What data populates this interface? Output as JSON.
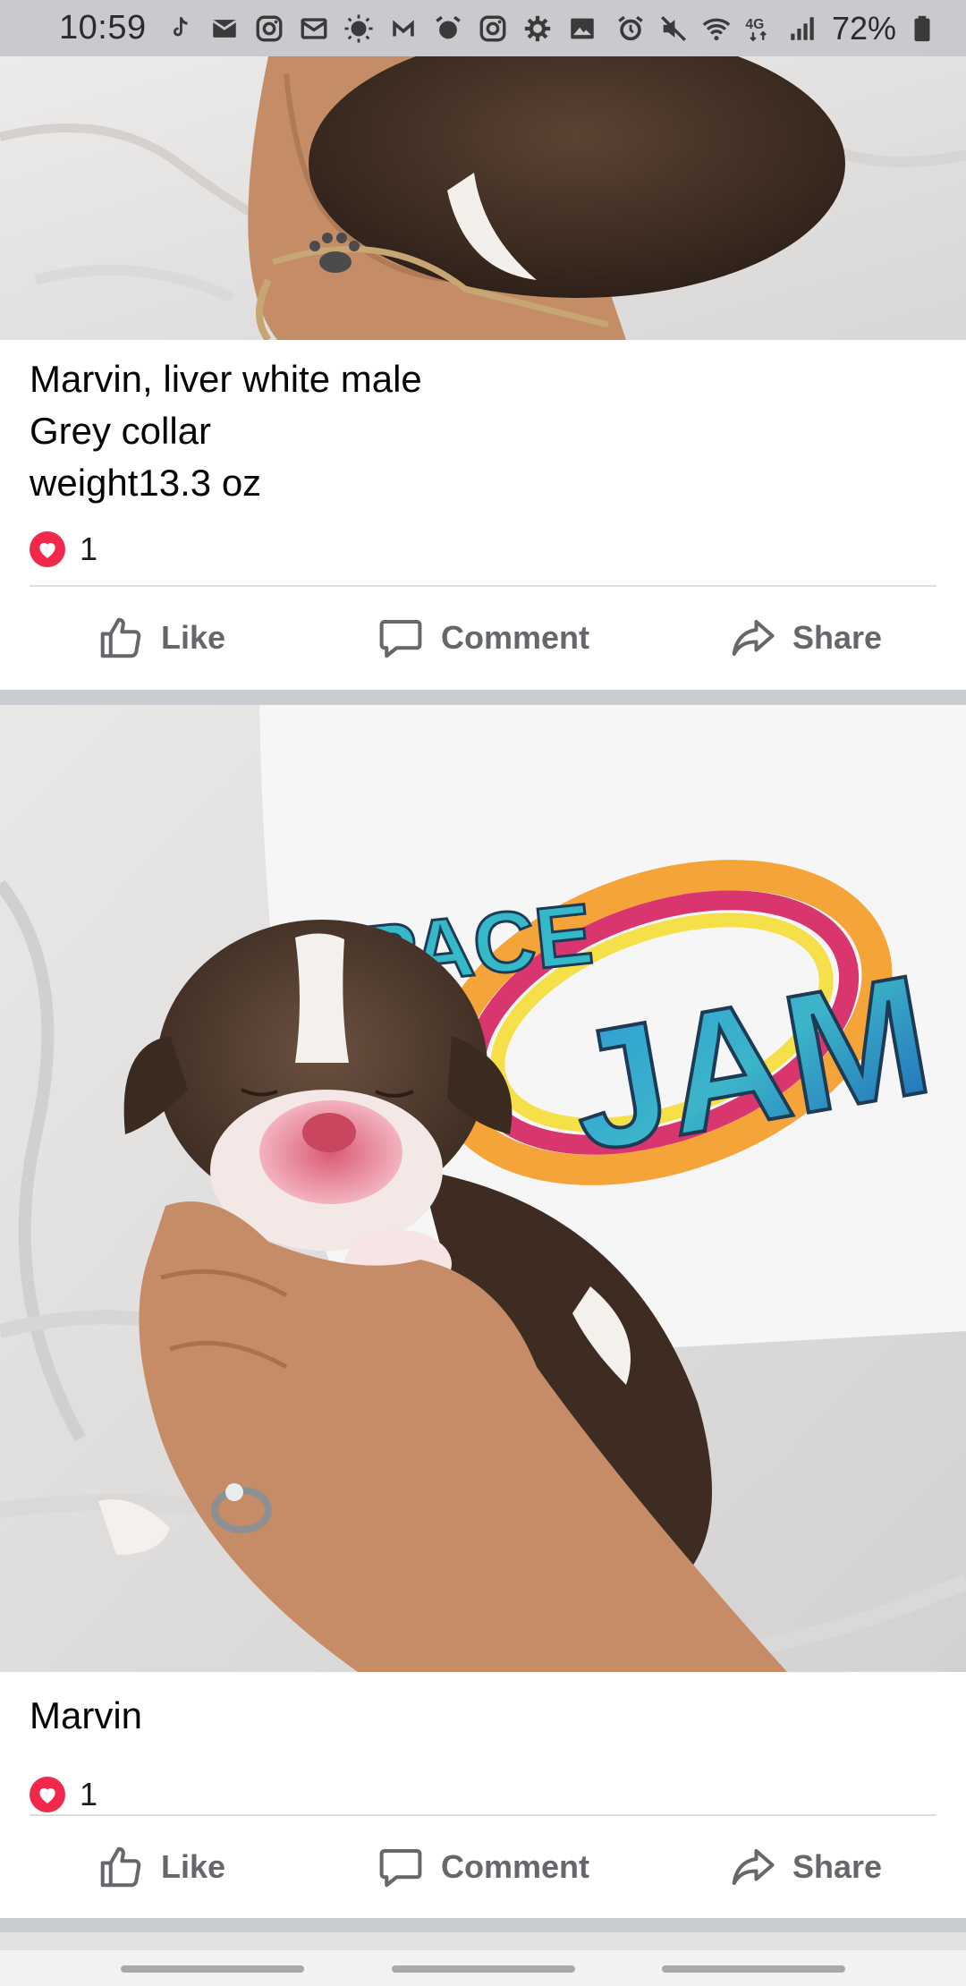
{
  "status_bar": {
    "time": "10:59",
    "battery": "72%",
    "left_icons": [
      "tiktok-icon",
      "mail-icon",
      "instagram-icon",
      "email-icon",
      "sun-icon",
      "gmail-icon",
      "alarm-icon",
      "instagram-icon",
      "gear-icon",
      "gallery-icon"
    ],
    "right_icons": [
      "alarm-icon",
      "mute-icon",
      "wifi-icon",
      "network-4g-icon",
      "signal-icon",
      "battery-icon"
    ]
  },
  "posts": [
    {
      "caption_lines": [
        "Marvin, liver white male",
        "Grey collar",
        "weight13.3 oz"
      ],
      "reaction_count": "1",
      "actions": {
        "like": "Like",
        "comment": "Comment",
        "share": "Share"
      }
    },
    {
      "caption_lines": [
        "Marvin"
      ],
      "reaction_count": "1",
      "image_logo_text": [
        "SPACE",
        "JAM"
      ],
      "actions": {
        "like": "Like",
        "comment": "Comment",
        "share": "Share"
      }
    }
  ],
  "colors": {
    "reaction_heart": "#f0284a",
    "action_text": "#65676b",
    "background": "#c9ccd1"
  }
}
